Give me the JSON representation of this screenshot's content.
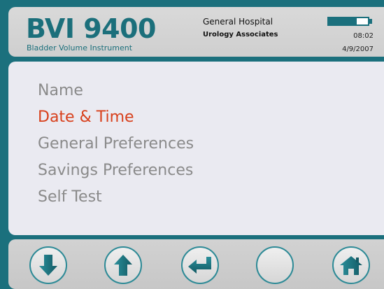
{
  "header": {
    "logo_title": "BVI 9400",
    "logo_subtitle": "Bladder Volume Instrument",
    "hospital": "General Hospital",
    "practice": "Urology Associates",
    "time": "08:02",
    "date": "4/9/2007",
    "battery_level": 0.72
  },
  "menu": {
    "items": [
      {
        "label": "Name",
        "selected": false
      },
      {
        "label": "Date & Time",
        "selected": true
      },
      {
        "label": "General Preferences",
        "selected": false
      },
      {
        "label": "Savings Preferences",
        "selected": false
      },
      {
        "label": "Self Test",
        "selected": false
      }
    ]
  },
  "footer": {
    "buttons": [
      {
        "name": "down-button",
        "icon": "arrow-down-icon"
      },
      {
        "name": "up-button",
        "icon": "arrow-up-icon"
      },
      {
        "name": "enter-button",
        "icon": "enter-return-icon"
      },
      {
        "name": "blank-button",
        "icon": ""
      },
      {
        "name": "home-button",
        "icon": "home-icon"
      }
    ]
  },
  "colors": {
    "frame": "#1b707d",
    "accent": "#1b6f7b",
    "selected": "#d8401c",
    "inactive": "#8a8a8a"
  }
}
